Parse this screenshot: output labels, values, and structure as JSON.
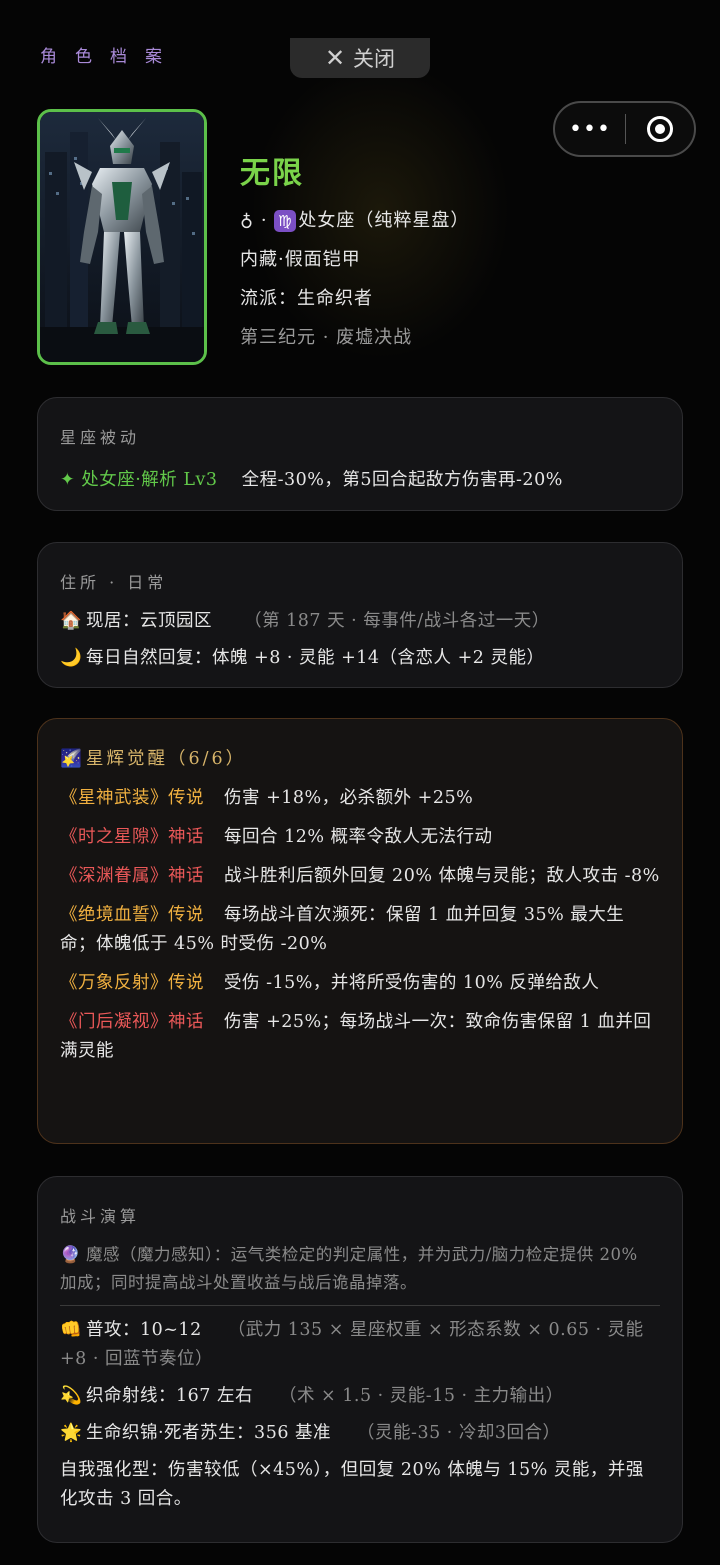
{
  "header": {
    "title": "角色档案",
    "close_label": "关闭"
  },
  "capsule": {
    "more_icon": "•••"
  },
  "profile": {
    "name": "无限",
    "gender_symbol": "♁",
    "zodiac_icon": "♍",
    "zodiac": "处女座（纯粹星盘）",
    "type": "内藏·假面铠甲",
    "school": "流派：生命织者",
    "era": "第三纪元 · 废墟决战"
  },
  "passive": {
    "title": "星座被动",
    "skill": "✦ 处女座·解析 Lv3",
    "desc": "全程-30%，第5回合起敌方伤害再-20%"
  },
  "residence": {
    "title": "住所 · 日常",
    "home_icon": "🏠",
    "home_label": "现居：云顶园区",
    "home_note": "（第 187 天 · 每事件/战斗各过一天）",
    "regen_icon": "🌙",
    "regen_text": "每日自然回复：体魄 +8 · 灵能 +14（含恋人 +2 灵能）"
  },
  "awakening": {
    "icon": "🌠",
    "title": "星辉觉醒（6/6）",
    "items": [
      {
        "name": "《星神武装》传说",
        "rarity": "legend",
        "desc": "伤害 +18%，必杀额外 +25%"
      },
      {
        "name": "《时之星隙》神话",
        "rarity": "myth",
        "desc": "每回合 12% 概率令敌人无法行动"
      },
      {
        "name": "《深渊眷属》神话",
        "rarity": "myth",
        "desc": "战斗胜利后额外回复 20% 体魄与灵能；敌人攻击 -8%"
      },
      {
        "name": "《绝境血誓》传说",
        "rarity": "legend",
        "desc": "每场战斗首次濒死：保留 1 血并回复 35% 最大生命；体魄低于 45% 时受伤 -20%"
      },
      {
        "name": "《万象反射》传说",
        "rarity": "legend",
        "desc": "受伤 -15%，并将所受伤害的 10% 反弹给敌人"
      },
      {
        "name": "《门后凝视》神话",
        "rarity": "myth",
        "desc": "伤害 +25%；每场战斗一次：致命伤害保留 1 血并回满灵能"
      }
    ]
  },
  "battle": {
    "title": "战斗演算",
    "intro_icon": "🔮",
    "intro": "魔感（魔力感知）：运气类检定的判定属性，并为武力/脑力检定提供 20% 加成；同时提高战斗处置收益与战后诡晶掉落。",
    "attacks": [
      {
        "icon": "👊",
        "label": "普攻：10~12",
        "note": "（武力 135 × 星座权重 × 形态系数 × 0.65 · 灵能+8 · 回蓝节奏位）"
      },
      {
        "icon": "💫",
        "label": "织命射线：167 左右",
        "note": "（术 × 1.5 · 灵能-15 · 主力输出）"
      },
      {
        "icon": "🌟",
        "label": "生命织锦·死者苏生：356 基准",
        "note": "（灵能-35 · 冷却3回合）"
      }
    ],
    "footer": "自我强化型：伤害较低（×45%），但回复 20% 体魄与 15% 灵能，并强化攻击 3 回合。"
  },
  "colors": {
    "accent_green": "#62c94a",
    "legend": "#f0b040",
    "myth": "#ea5858",
    "header_purple": "#a98ad8"
  }
}
